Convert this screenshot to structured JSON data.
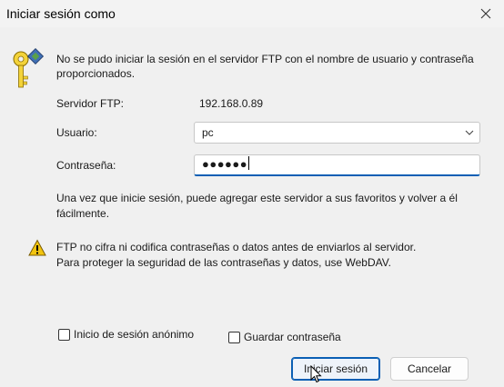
{
  "window": {
    "title": "Iniciar sesión como"
  },
  "message": {
    "line1": "No se pudo iniciar la sesión en el servidor FTP con el nombre de usuario y contraseña",
    "line2": "proporcionados."
  },
  "server": {
    "label": "Servidor FTP:",
    "value": "192.168.0.89"
  },
  "user": {
    "label": "Usuario:",
    "value": "pc"
  },
  "password": {
    "label": "Contraseña:",
    "masked": "●●●●●●"
  },
  "info": {
    "line1": "Una vez que inicie sesión, puede agregar este servidor a sus favoritos y volver a él",
    "line2": "fácilmente."
  },
  "warning": {
    "line1": "FTP no cifra ni codifica contraseñas o datos antes de enviarlos al servidor.",
    "line2": "Para proteger la seguridad de las contraseñas y datos, use WebDAV."
  },
  "options": {
    "anonymous": {
      "label": "Inicio de sesión anónimo",
      "checked": false
    },
    "save_password": {
      "label": "Guardar contraseña",
      "checked": false
    }
  },
  "buttons": {
    "login": "Iniciar sesión",
    "cancel": "Cancelar"
  },
  "icons": {
    "close": "close-icon",
    "key": "key-icon",
    "dropdown": "chevron-down-icon",
    "warning": "warning-icon",
    "cursor": "mouse-pointer-icon"
  },
  "colors": {
    "accent": "#0a5fb4",
    "warning": "#f2c40f"
  }
}
